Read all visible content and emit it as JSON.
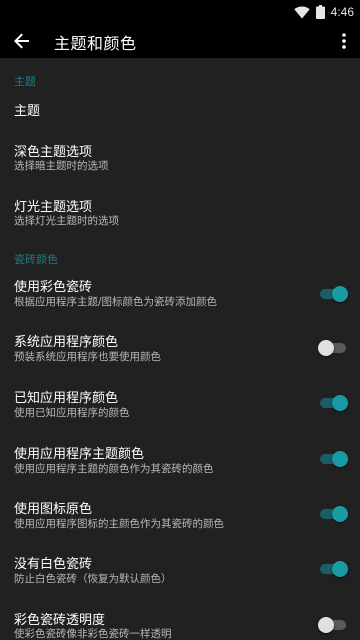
{
  "status": {
    "time": "4:46"
  },
  "app_bar": {
    "title": "主题和颜色"
  },
  "sections": {
    "theme": {
      "header": "主题"
    },
    "tiles": {
      "header": "瓷砖颜色"
    }
  },
  "items": {
    "theme": {
      "title": "主题"
    },
    "dark_theme": {
      "title": "深色主题选项",
      "summary": "选择暗主题时的选项"
    },
    "light_theme": {
      "title": "灯光主题选项",
      "summary": "选择灯光主题时的选项"
    },
    "color_tiles": {
      "title": "使用彩色瓷砖",
      "summary": "根据应用程序主题/图标颜色为瓷砖添加颜色",
      "checked": true
    },
    "system_app_colors": {
      "title": "系统应用程序颜色",
      "summary": "预装系统应用程序也要使用颜色",
      "checked": false
    },
    "known_app_colors": {
      "title": "已知应用程序颜色",
      "summary": "使用已知应用程序的颜色",
      "checked": true
    },
    "app_theme_colors": {
      "title": "使用应用程序主题颜色",
      "summary": "使用应用程序主题的颜色作为其瓷砖的颜色",
      "checked": true
    },
    "icon_colors": {
      "title": "使用图标原色",
      "summary": "使用应用程序图标的主颜色作为其瓷砖的颜色",
      "checked": true
    },
    "no_white_tiles": {
      "title": "没有白色瓷砖",
      "summary": "防止白色瓷砖（恢复为默认颜色）",
      "checked": true
    },
    "tile_transparency": {
      "title": "彩色瓷砖透明度",
      "summary": "使彩色瓷砖像非彩色瓷砖一样透明",
      "checked": false
    }
  },
  "colors": {
    "accent": "#1a9aa4",
    "section_header": "#1e7d85",
    "background": "#212121"
  },
  "icons": {
    "back": "arrow-left-icon",
    "more": "more-vertical-icon",
    "wifi": "wifi-icon",
    "battery": "battery-icon"
  }
}
